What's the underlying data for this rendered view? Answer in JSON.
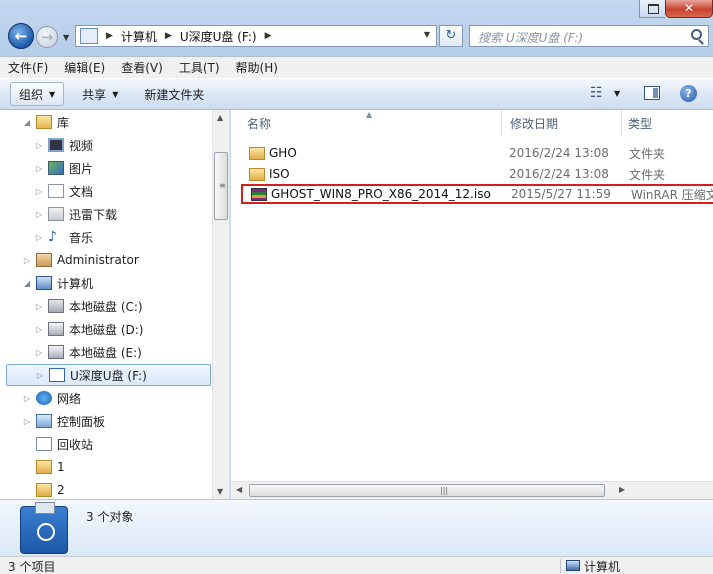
{
  "window": {
    "close_label": "✕",
    "address_crumbs": [
      "计算机",
      "U深度U盘 (F:)"
    ],
    "search_placeholder": "搜索 U深度U盘 (F:)"
  },
  "menubar": [
    "文件(F)",
    "编辑(E)",
    "查看(V)",
    "工具(T)",
    "帮助(H)"
  ],
  "toolbar": {
    "organize": "组织",
    "share": "共享",
    "new_folder": "新建文件夹",
    "help_glyph": "?"
  },
  "nav": {
    "items": [
      {
        "label": "库",
        "icon": "library-icon",
        "level": 0,
        "expanded": true
      },
      {
        "label": "视频",
        "icon": "video-library-icon",
        "level": 1
      },
      {
        "label": "图片",
        "icon": "picture-library-icon",
        "level": 1
      },
      {
        "label": "文档",
        "icon": "document-library-icon",
        "level": 1
      },
      {
        "label": "迅雷下载",
        "icon": "download-library-icon",
        "level": 1
      },
      {
        "label": "音乐",
        "icon": "music-library-icon",
        "level": 1
      },
      {
        "label": "Administrator",
        "icon": "user-folder-icon",
        "level": 0
      },
      {
        "label": "计算机",
        "icon": "computer-icon",
        "level": 0,
        "expanded": true
      },
      {
        "label": "本地磁盘 (C:)",
        "icon": "system-drive-icon",
        "level": 1
      },
      {
        "label": "本地磁盘 (D:)",
        "icon": "drive-icon",
        "level": 1
      },
      {
        "label": "本地磁盘 (E:)",
        "icon": "drive-icon",
        "level": 1
      },
      {
        "label": "U深度U盘 (F:)",
        "icon": "usb-drive-icon",
        "level": 1,
        "selected": true
      },
      {
        "label": "网络",
        "icon": "network-icon",
        "level": 0
      },
      {
        "label": "控制面板",
        "icon": "control-panel-icon",
        "level": 0
      },
      {
        "label": "回收站",
        "icon": "recycle-bin-icon",
        "level": 0
      },
      {
        "label": "1",
        "icon": "folder-icon",
        "level": 0
      },
      {
        "label": "2",
        "icon": "folder-icon",
        "level": 0
      }
    ]
  },
  "columns": {
    "name": "名称",
    "date": "修改日期",
    "type": "类型"
  },
  "files": [
    {
      "name": "GHO",
      "date": "2016/2/24 13:08",
      "type": "文件夹",
      "icon": "folder-icon"
    },
    {
      "name": "ISO",
      "date": "2016/2/24 13:08",
      "type": "文件夹",
      "icon": "folder-icon"
    },
    {
      "name": "GHOST_WIN8_PRO_X86_2014_12.iso",
      "date": "2015/5/27 11:59",
      "type": "WinRAR 压缩文",
      "icon": "winrar-archive-icon",
      "highlighted": true
    }
  ],
  "details": {
    "count": "3 个对象"
  },
  "status": {
    "items": "3 个项目",
    "location": "计算机"
  },
  "colors": {
    "highlight_border": "#d41f1f",
    "selection": "#d9e8fa"
  }
}
